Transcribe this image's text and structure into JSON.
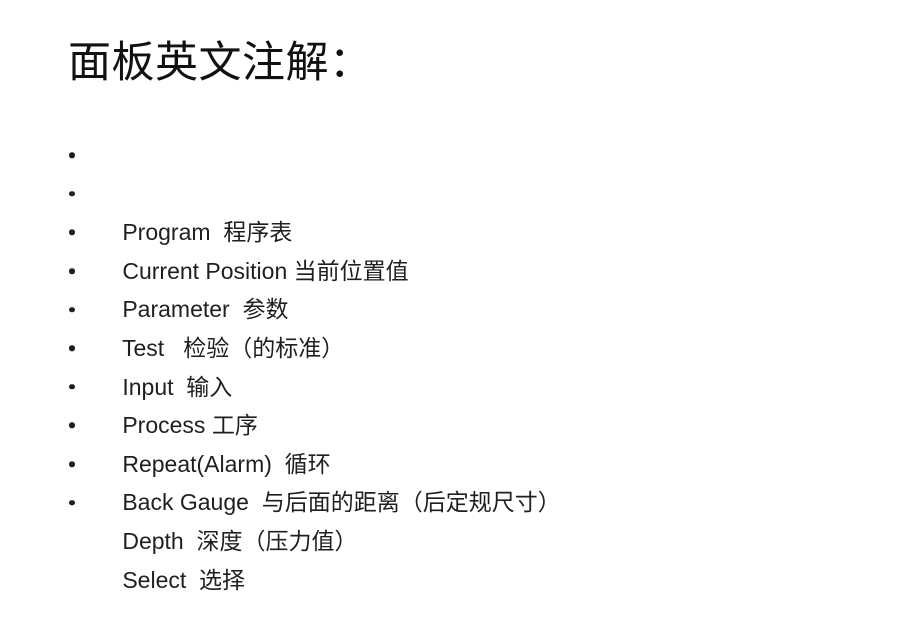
{
  "slide": {
    "title": "面板英文注解：",
    "background_color": "#ffffff",
    "text_color": "#1f1f1f",
    "bullet_glyph": "•",
    "items": [
      {
        "en": "Program",
        "zh": "程序表",
        "text": "Program  程序表"
      },
      {
        "en": "Current Position",
        "zh": "当前位置值",
        "text": "Current Position 当前位置值"
      },
      {
        "en": "Parameter",
        "zh": "参数",
        "text": "Parameter  参数"
      },
      {
        "en": "Test",
        "zh": "检验（的标准）",
        "text": "Test   检验（的标准）"
      },
      {
        "en": "Input",
        "zh": "输入",
        "text": "Input  输入"
      },
      {
        "en": "Process",
        "zh": "工序",
        "text": "Process 工序"
      },
      {
        "en": "Repeat(Alarm)",
        "zh": "循环",
        "text": "Repeat(Alarm)  循环"
      },
      {
        "en": "Back Gauge",
        "zh": "与后面的距离（后定规尺寸）",
        "text": "Back Gauge  与后面的距离（后定规尺寸）"
      },
      {
        "en": "Depth",
        "zh": "深度（压力值）",
        "text": "Depth  深度（压力值）"
      },
      {
        "en": "Select",
        "zh": "选择",
        "text": "Select  选择"
      }
    ]
  }
}
